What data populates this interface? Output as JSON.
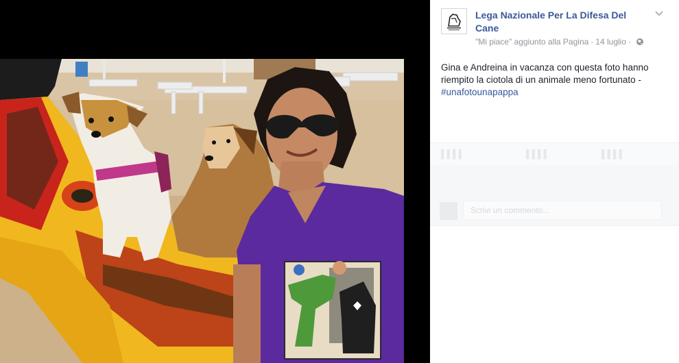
{
  "post": {
    "page_name": "Lega Nazionale Per La Difesa Del Cane",
    "meta_liked": "\"Mi piace\" aggiunto alla Pagina",
    "meta_separator": "·",
    "meta_date": "14 luglio",
    "text": "Gina e Andreina in vacanza con questa foto hanno riempito la ciotola di un animale meno fortunato -",
    "hashtag": "#unafotounapappa"
  },
  "comment": {
    "placeholder": "Scrivi un commento..."
  },
  "icons": {
    "options": "chevron-down-icon",
    "audience": "globe-icon",
    "logo": "page-logo"
  },
  "colors": {
    "link": "#3b5998",
    "meta": "#90949c",
    "shirt": "#5b2a9e"
  }
}
